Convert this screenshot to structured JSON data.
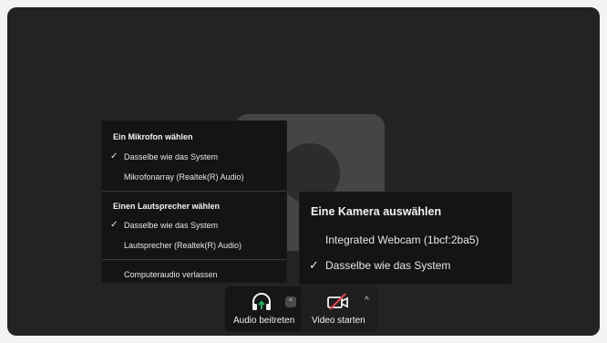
{
  "mic_menu": {
    "mic_header": "Ein Mikrofon wählen",
    "mic_items": [
      {
        "label": "Dasselbe wie das System",
        "checked": true
      },
      {
        "label": "Mikrofonarray (Realtek(R) Audio)",
        "checked": false
      }
    ],
    "speaker_header": "Einen Lautsprecher wählen",
    "speaker_items": [
      {
        "label": "Dasselbe wie das System",
        "checked": true
      },
      {
        "label": "Lautsprecher (Realtek(R) Audio)",
        "checked": false
      }
    ],
    "leave_audio": "Computeraudio verlassen"
  },
  "camera_menu": {
    "header": "Eine Kamera auswählen",
    "items": [
      {
        "label": "Integrated Webcam (1bcf:2ba5)",
        "checked": false
      },
      {
        "label": "Dasselbe wie das System",
        "checked": true
      }
    ]
  },
  "toolbar": {
    "audio_label": "Audio beitreten",
    "video_label": "Video starten",
    "check_glyph": "✓",
    "caret_glyph": "^"
  },
  "colors": {
    "stage": "#232323",
    "menu": "#141414",
    "audio_icon_accent": "#1bb760",
    "video_off_slash": "#e0404a"
  },
  "icons": [
    "headphones-icon",
    "video-off-icon",
    "chevron-up-icon",
    "check-icon"
  ]
}
